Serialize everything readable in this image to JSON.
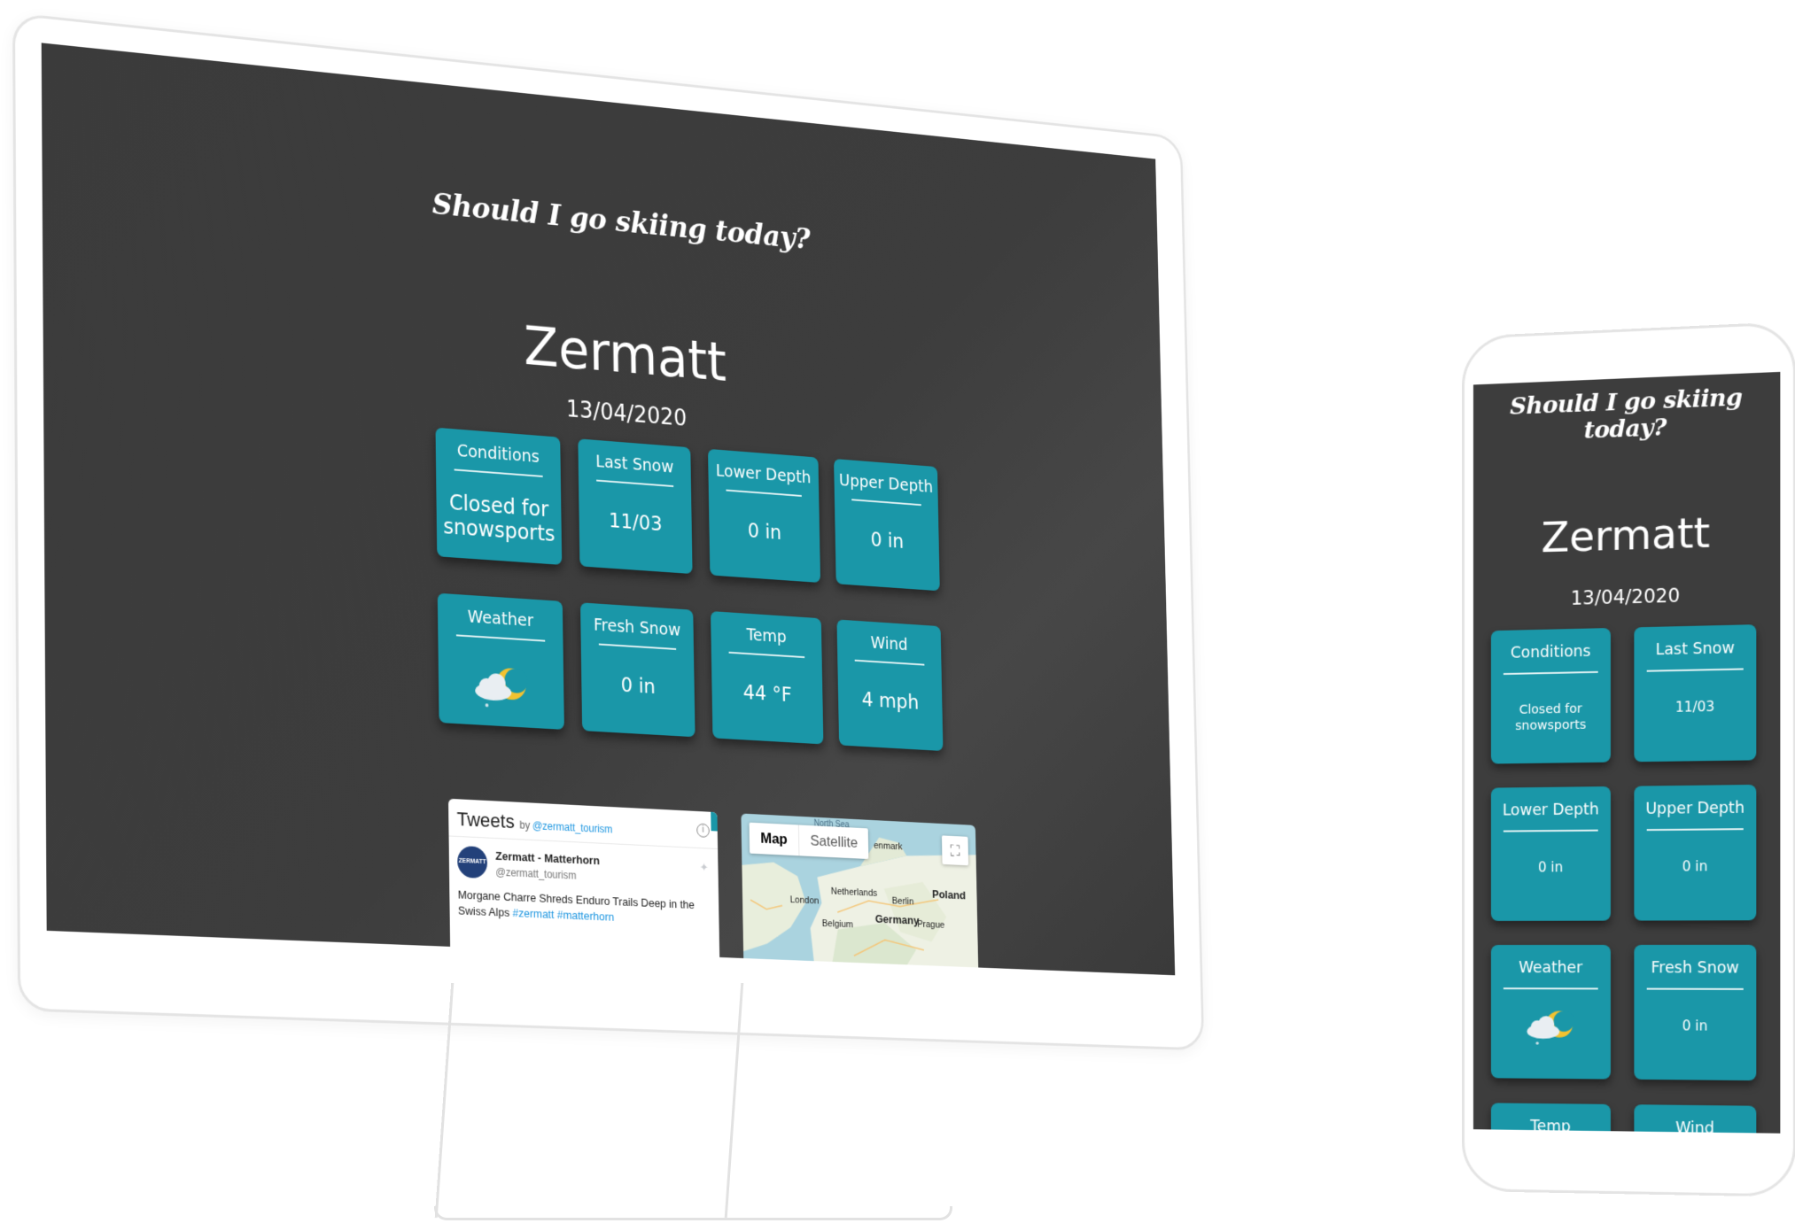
{
  "app": {
    "title": "Should I go skiing today?"
  },
  "resort": {
    "name": "Zermatt",
    "date": "13/04/2020"
  },
  "cards": {
    "conditions": {
      "label": "Conditions",
      "value": "Closed for snowsports"
    },
    "last_snow": {
      "label": "Last Snow",
      "value": "11/03"
    },
    "lower_depth": {
      "label": "Lower Depth",
      "value": "0 in"
    },
    "upper_depth": {
      "label": "Upper Depth",
      "value": "0 in"
    },
    "weather": {
      "label": "Weather",
      "icon": "partly-cloudy-night-snow-icon"
    },
    "fresh_snow": {
      "label": "Fresh Snow",
      "value": "0 in"
    },
    "temp": {
      "label": "Temp",
      "value": "44 °F"
    },
    "wind": {
      "label": "Wind",
      "value": "4 mph"
    }
  },
  "tweets": {
    "title": "Tweets",
    "by": "by",
    "handle_link": "@zermatt_tourism",
    "tweet": {
      "avatar_text": "ZERMATT",
      "author": "Zermatt - Matterhorn",
      "handle": "@zermatt_tourism",
      "text": "Morgane Charre Shreds Enduro Trails Deep in the Swiss Alps",
      "tags": "#zermatt #matterhorn"
    }
  },
  "map": {
    "type_buttons": [
      "Map",
      "Satellite"
    ],
    "active_type": "Map",
    "labels": {
      "sea": "North Sea",
      "london": "London",
      "netherlands": "Netherlands",
      "berlin": "Berlin",
      "poland": "Poland",
      "germany": "Germany",
      "belgium": "Belgium",
      "prague": "Prague",
      "denmark": "enmark"
    }
  },
  "colors": {
    "card_bg": "#1a97a8",
    "screen_bg": "#3d3d3d",
    "text": "#ffffff",
    "link": "#1b95e0"
  }
}
